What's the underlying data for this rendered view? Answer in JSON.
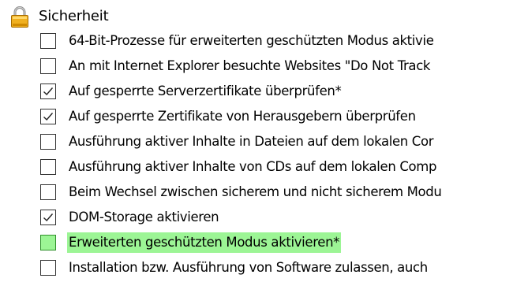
{
  "group": {
    "icon": "lock-icon",
    "label": "Sicherheit"
  },
  "options": [
    {
      "label": "64-Bit-Prozesse für erweiterten geschützten Modus aktivie",
      "checked": false,
      "highlighted": false
    },
    {
      "label": "An mit Internet Explorer besuchte Websites \"Do Not Track",
      "checked": false,
      "highlighted": false
    },
    {
      "label": "Auf gesperrte Serverzertifikate überprüfen*",
      "checked": true,
      "highlighted": false
    },
    {
      "label": "Auf gesperrte Zertifikate von Herausgebern überprüfen",
      "checked": true,
      "highlighted": false
    },
    {
      "label": "Ausführung aktiver Inhalte in Dateien auf dem lokalen Cor",
      "checked": false,
      "highlighted": false
    },
    {
      "label": "Ausführung aktiver Inhalte von CDs auf dem lokalen Comp",
      "checked": false,
      "highlighted": false
    },
    {
      "label": "Beim Wechsel zwischen sicherem und nicht sicherem Modu",
      "checked": false,
      "highlighted": false
    },
    {
      "label": "DOM-Storage aktivieren",
      "checked": true,
      "highlighted": false
    },
    {
      "label": "Erweiterten geschützten Modus aktivieren*",
      "checked": false,
      "highlighted": true
    },
    {
      "label": "Installation bzw. Ausführung von Software zulassen, auch",
      "checked": false,
      "highlighted": false
    }
  ],
  "colors": {
    "highlight": "#9cf595",
    "lock_body": "#f0b020"
  }
}
